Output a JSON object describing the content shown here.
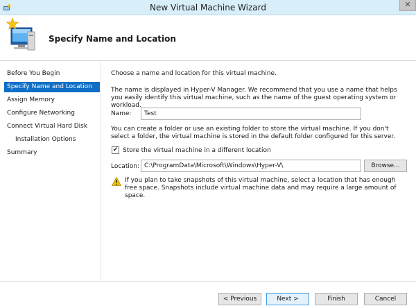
{
  "window": {
    "title": "New Virtual Machine Wizard",
    "close_glyph": "✕"
  },
  "header": {
    "page_title": "Specify Name and Location",
    "icon": "wizard-computer-icon"
  },
  "sidebar": {
    "items": [
      {
        "label": "Before You Begin",
        "active": false,
        "sub": false
      },
      {
        "label": "Specify Name and Location",
        "active": true,
        "sub": false
      },
      {
        "label": "Assign Memory",
        "active": false,
        "sub": false
      },
      {
        "label": "Configure Networking",
        "active": false,
        "sub": false
      },
      {
        "label": "Connect Virtual Hard Disk",
        "active": false,
        "sub": false
      },
      {
        "label": "Installation Options",
        "active": false,
        "sub": true
      },
      {
        "label": "Summary",
        "active": false,
        "sub": false
      }
    ]
  },
  "content": {
    "intro": "Choose a name and location for this virtual machine.",
    "name_help": "The name is displayed in Hyper-V Manager. We recommend that you use a name that helps you easily identify this virtual machine, such as the name of the guest operating system or workload.",
    "name_label": "Name:",
    "name_value": "Test",
    "folder_help": "You can create a folder or use an existing folder to store the virtual machine. If you don't select a folder, the virtual machine is stored in the default folder configured for this server.",
    "store_checkbox_label": "Store the virtual machine in a different location",
    "store_checkbox_checked": true,
    "checkmark_glyph": "✔",
    "location_label": "Location:",
    "location_value": "C:\\ProgramData\\Microsoft\\Windows\\Hyper-V\\",
    "browse_label": "Browse...",
    "warning_icon": "warning-icon",
    "warning_text": "If you plan to take snapshots of this virtual machine, select a location that has enough free space. Snapshots include virtual machine data and may require a large amount of space."
  },
  "footer": {
    "previous_label": "< Previous",
    "next_label": "Next >",
    "finish_label": "Finish",
    "cancel_label": "Cancel"
  },
  "colors": {
    "titlebar_bg": "#d8eef9",
    "active_nav_bg": "#0f6fc6",
    "default_button_border": "#3c9ae4",
    "warning_yellow": "#f2c200"
  }
}
